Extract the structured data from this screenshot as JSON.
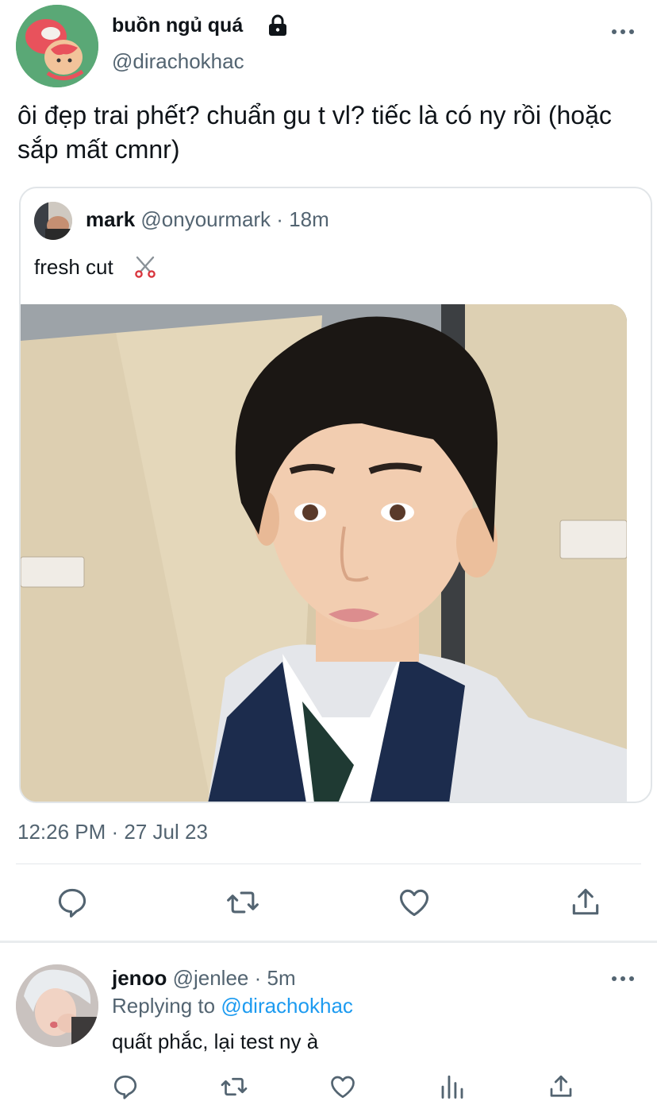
{
  "tweet": {
    "display_name": "buồn ngủ quá",
    "handle": "@dirachokhac",
    "text": "ôi đẹp trai phết? chuẩn gu t vl? tiếc là có ny rồi (hoặc sắp mất cmnr)",
    "timestamp": "12:26 PM · 27 Jul 23"
  },
  "quote": {
    "name": "mark",
    "handle": "@onyourmark",
    "separator": "·",
    "time": "18m",
    "text": "fresh cut"
  },
  "actions": [
    "reply-icon",
    "retweet-icon",
    "like-icon",
    "share-icon"
  ],
  "reply": {
    "name": "jenoo",
    "handle": "@jenlee",
    "separator": "·",
    "time": "5m",
    "replying_prefix": "Replying to",
    "replying_user": "@dirachokhac",
    "text": "quất phắc, lại test ny à"
  },
  "colors": {
    "text": "#0f1419",
    "secondary": "#536471",
    "link": "#1d9bf0",
    "border": "#e1e5e8"
  }
}
